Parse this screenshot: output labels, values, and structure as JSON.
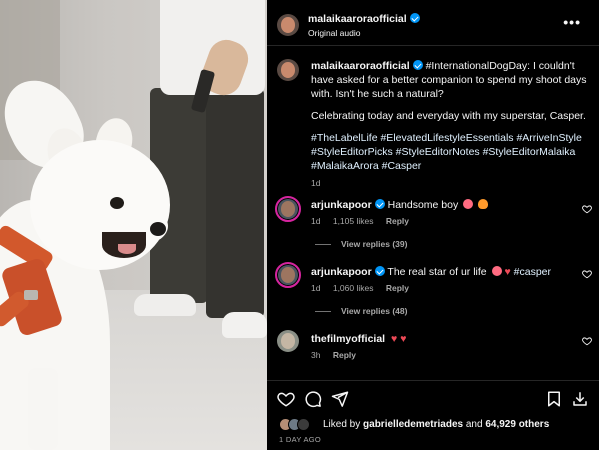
{
  "post": {
    "username": "malaikaaroraofficial",
    "audio": "Original audio"
  },
  "caption": {
    "username": "malaikaaroraofficial",
    "text": "#InternationalDogDay: I couldn't have asked for a better companion to spend my shoot days with. Isn't he such a natural?",
    "text2": "Celebrating today and everyday with my superstar, Casper.",
    "hashtags": "#TheLabelLife  #ElevatedLifestyleEssentials  #ArriveInStyle #StyleEditorPicks #StyleEditorNotes #StyleEditorMalaika #MalaikaArora #Casper",
    "time": "1d"
  },
  "comments": [
    {
      "username": "arjunkapoor",
      "text": "Handsome boy",
      "time": "1d",
      "likes": "1,105 likes",
      "reply": "Reply",
      "view_replies": "View replies (39)"
    },
    {
      "username": "arjunkapoor",
      "text": "The real star of ur life",
      "tag": "#casper",
      "time": "1d",
      "likes": "1,060 likes",
      "reply": "Reply",
      "view_replies": "View replies (48)"
    },
    {
      "username": "thefilmyofficial",
      "text": "",
      "time": "3h",
      "reply": "Reply"
    }
  ],
  "footer": {
    "liked_by_prefix": "Liked by",
    "liked_by_user": "gabrielledemetriades",
    "and": "and",
    "others": "64,929 others",
    "timestamp": "1 DAY AGO"
  },
  "icons": [
    "heart-icon",
    "comment-icon",
    "share-icon",
    "bookmark-icon",
    "download-icon",
    "more-icon",
    "verified-icon"
  ],
  "colors": {
    "background": "#000000",
    "verified": "#0095f6",
    "muted": "#a8a8a8",
    "heart_emoji": "#ed4956",
    "story_ring": "#d6249f"
  }
}
